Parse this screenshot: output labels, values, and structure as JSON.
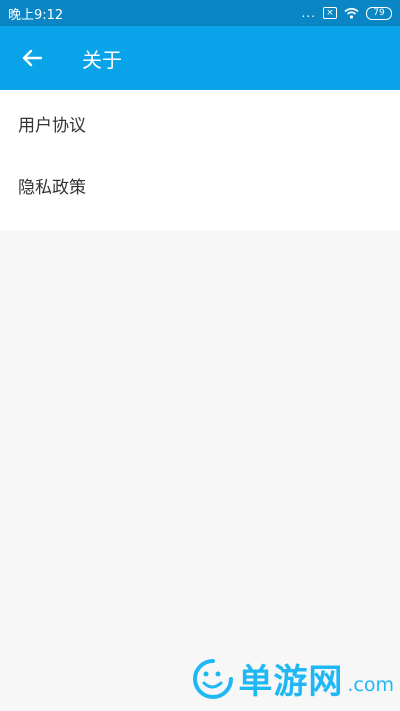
{
  "status_bar": {
    "time": "晚上9:12",
    "notifications": "...",
    "battery": "79"
  },
  "app_bar": {
    "title": "关于"
  },
  "menu": {
    "items": [
      {
        "label": "用户协议"
      },
      {
        "label": "隐私政策"
      }
    ]
  },
  "watermark": {
    "text": "单游网",
    "suffix": ".com"
  },
  "colors": {
    "status_bar": "#0a86c4",
    "app_bar": "#08a3e8",
    "watermark": "#1fb8f5"
  },
  "icons": {
    "back": "arrow-left",
    "wifi": "wifi",
    "sim": "sim-no-signal",
    "battery": "battery",
    "logo": "smiley"
  }
}
